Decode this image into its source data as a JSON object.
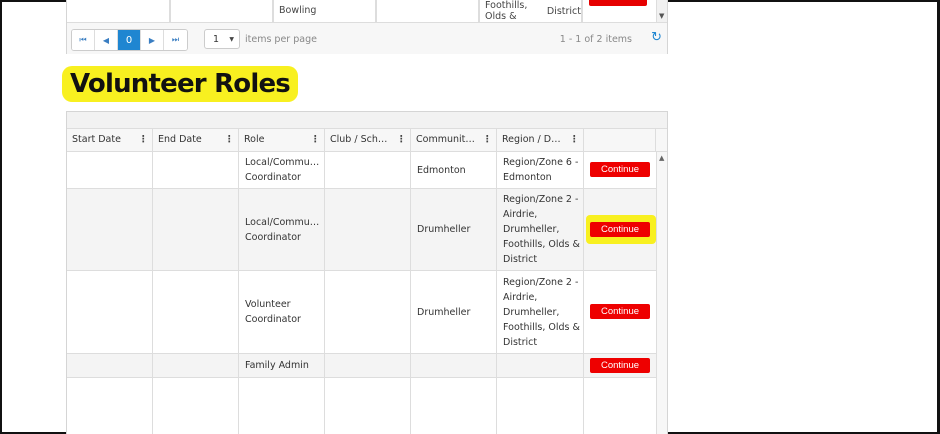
{
  "top_grid": {
    "row": {
      "col3": "Bowling",
      "col5_lines": [
        "Foothills, Olds &",
        "District"
      ]
    },
    "pager": {
      "first": "⏮",
      "prev": "◀",
      "current_page": "0",
      "next": "▶",
      "last": "⏭",
      "page_size": "1",
      "items_per_page_label": "items per page",
      "info": "1 - 1 of 2 items"
    }
  },
  "section": {
    "title": "Volunteer Roles"
  },
  "grid": {
    "columns": [
      "Start Date",
      "End Date",
      "Role",
      "Club / Sch…",
      "Communit…",
      "Region / D…"
    ],
    "rows": [
      {
        "start": "",
        "end": "",
        "role": [
          "Local/Commu…",
          "Coordinator"
        ],
        "club": "",
        "community": "Edmonton",
        "region": [
          "Region/Zone 6 -",
          "Edmonton"
        ],
        "action": "Continue"
      },
      {
        "start": "",
        "end": "",
        "role": [
          "Local/Commu…",
          "Coordinator"
        ],
        "club": "",
        "community": "Drumheller",
        "region": [
          "Region/Zone 2 -",
          "Airdrie,",
          "Drumheller,",
          "Foothills, Olds &",
          "District"
        ],
        "action": "Continue"
      },
      {
        "start": "",
        "end": "",
        "role": [
          "Volunteer",
          "Coordinator"
        ],
        "club": "",
        "community": "Drumheller",
        "region": [
          "Region/Zone 2 -",
          "Airdrie,",
          "Drumheller,",
          "Foothills, Olds &",
          "District"
        ],
        "action": "Continue"
      },
      {
        "start": "",
        "end": "",
        "role": [
          "Family Admin"
        ],
        "club": "",
        "community": "",
        "region": [],
        "action": "Continue"
      }
    ]
  },
  "colors": {
    "accent_red": "#ee0000",
    "highlight_yellow": "#f8f020",
    "pager_active": "#1f86d1"
  },
  "icons": {
    "column_menu": "kebab-menu-icon",
    "refresh": "refresh-icon",
    "dropdown": "caret-down-icon",
    "scroll_up": "scroll-up-arrow-icon",
    "scroll_down": "scroll-down-arrow-icon"
  }
}
